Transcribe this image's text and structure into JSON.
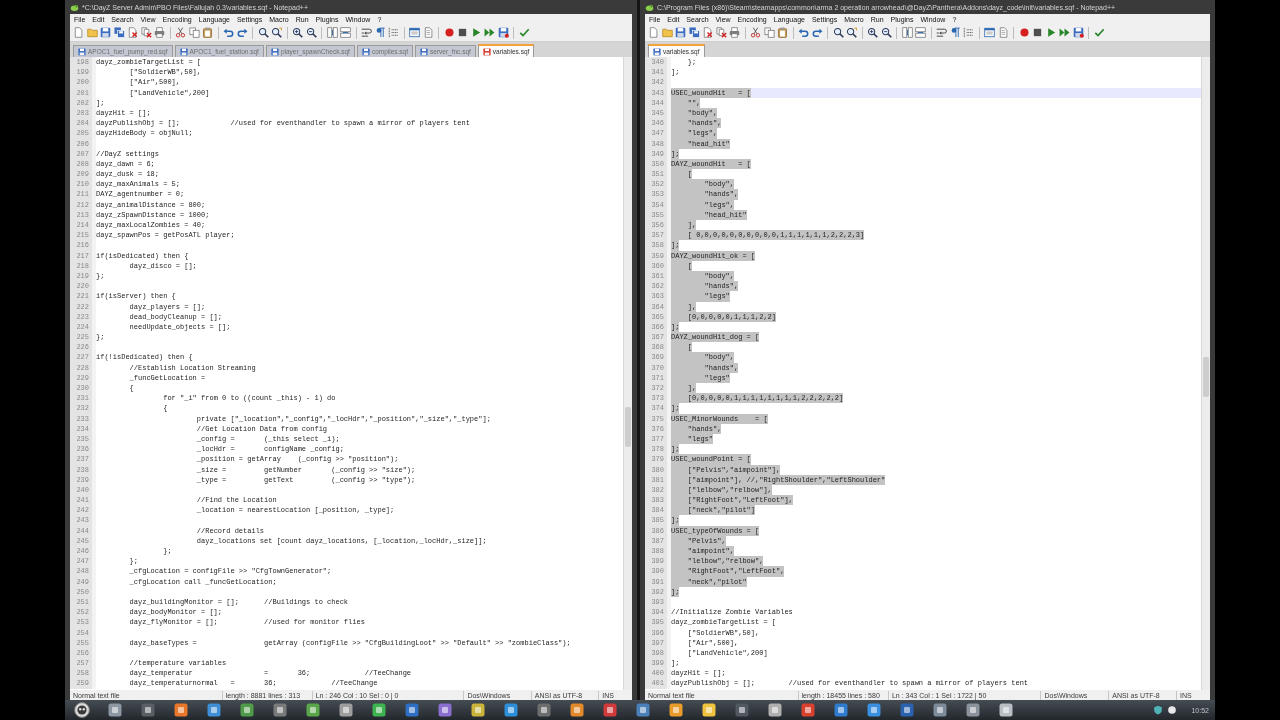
{
  "windows": [
    {
      "title": "*C:\\DayZ Server Admin\\PBO Files\\Fallujah 0.3\\variables.sqf - Notepad++",
      "menu": [
        "File",
        "Edit",
        "Search",
        "View",
        "Encoding",
        "Language",
        "Settings",
        "Macro",
        "Run",
        "Plugins",
        "Window",
        "?"
      ],
      "tabs": [
        {
          "label": "APOC1_fuel_pump_red.sqf",
          "selected": false,
          "modified": false
        },
        {
          "label": "APOC1_fuel_station.sqf",
          "selected": false,
          "modified": false
        },
        {
          "label": "player_spawnCheck.sqf",
          "selected": false,
          "modified": false
        },
        {
          "label": "compiles.sqf",
          "selected": false,
          "modified": false
        },
        {
          "label": "server_fnc.sqf",
          "selected": false,
          "modified": false
        },
        {
          "label": "variables.sqf",
          "selected": true,
          "modified": true
        }
      ],
      "editor": {
        "lines": [
          {
            "number": "198",
            "text": "dayz_zombieTargetList = [",
            "selected": false,
            "current": false
          },
          {
            "number": "199",
            "text": "\t[\"SoldierWB\",50],",
            "selected": false,
            "current": false
          },
          {
            "number": "200",
            "text": "\t[\"Air\",500],",
            "selected": false,
            "current": false
          },
          {
            "number": "201",
            "text": "\t[\"LandVehicle\",200]",
            "selected": false,
            "current": false
          },
          {
            "number": "202",
            "text": "];",
            "selected": false,
            "current": false
          },
          {
            "number": "203",
            "text": "dayzHit = [];",
            "selected": false,
            "current": false
          },
          {
            "number": "204",
            "text": "dayzPublishObj = [];\t\t//used for eventhandler to spawn a mirror of players tent",
            "selected": false,
            "current": false
          },
          {
            "number": "205",
            "text": "dayzHideBody = objNull;",
            "selected": false,
            "current": false
          },
          {
            "number": "206",
            "selected": false,
            "current": false
          },
          {
            "number": "207",
            "text": "//DayZ settings",
            "selected": false,
            "current": false
          },
          {
            "number": "208",
            "text": "dayz_dawn = 6;",
            "selected": false,
            "current": false
          },
          {
            "number": "209",
            "text": "dayz_dusk = 18;",
            "selected": false,
            "current": false
          },
          {
            "number": "210",
            "text": "dayz_maxAnimals = 5;",
            "selected": false,
            "current": false
          },
          {
            "number": "211",
            "text": "DAYZ_agentnumber = 0;",
            "selected": false,
            "current": false
          },
          {
            "number": "212",
            "text": "dayz_animalDistance = 800;",
            "selected": false,
            "current": false
          },
          {
            "number": "213",
            "text": "dayz_zSpawnDistance = 1000;",
            "selected": false,
            "current": false
          },
          {
            "number": "214",
            "text": "dayz_maxLocalZombies = 40;",
            "selected": false,
            "current": false
          },
          {
            "number": "215",
            "text": "dayz_spawnPos = getPosATL player;",
            "selected": false,
            "current": false
          },
          {
            "number": "216",
            "selected": false,
            "current": false
          },
          {
            "number": "217",
            "text": "if(isDedicated) then {",
            "selected": false,
            "current": false
          },
          {
            "number": "218",
            "text": "\tdayz_disco = [];",
            "selected": false,
            "current": false
          },
          {
            "number": "219",
            "text": "};",
            "selected": false,
            "current": false
          },
          {
            "number": "220",
            "selected": false,
            "current": false
          },
          {
            "number": "221",
            "text": "if(isServer) then {",
            "selected": false,
            "current": false
          },
          {
            "number": "222",
            "text": "\tdayz_players = [];",
            "selected": false,
            "current": false
          },
          {
            "number": "223",
            "text": "\tdead_bodyCleanup = [];",
            "selected": false,
            "current": false
          },
          {
            "number": "224",
            "text": "\tneedUpdate_objects = [];",
            "selected": false,
            "current": false
          },
          {
            "number": "225",
            "text": "};",
            "selected": false,
            "current": false
          },
          {
            "number": "226",
            "selected": false,
            "current": false
          },
          {
            "number": "227",
            "text": "if(!isDedicated) then {",
            "selected": false,
            "current": false
          },
          {
            "number": "228",
            "text": "\t//Establish Location Streaming",
            "selected": false,
            "current": false
          },
          {
            "number": "229",
            "text": "\t_funcGetLocation =",
            "selected": false,
            "current": false
          },
          {
            "number": "230",
            "text": "\t{",
            "selected": false,
            "current": false
          },
          {
            "number": "231",
            "text": "\t\tfor \"_i\" from 0 to ((count _this) - 1) do",
            "selected": false,
            "current": false
          },
          {
            "number": "232",
            "text": "\t\t{",
            "selected": false,
            "current": false
          },
          {
            "number": "233",
            "text": "\t\t\tprivate [\"_location\",\"_config\",\"_locHdr\",\"_position\",\"_size\",\"_type\"];",
            "selected": false,
            "current": false
          },
          {
            "number": "234",
            "text": "\t\t\t//Get Location Data from config",
            "selected": false,
            "current": false
          },
          {
            "number": "235",
            "text": "\t\t\t_config = \t(_this select _i);",
            "selected": false,
            "current": false
          },
          {
            "number": "236",
            "text": "\t\t\t_locHdr = \tconfigName _config;",
            "selected": false,
            "current": false
          },
          {
            "number": "237",
            "text": "\t\t\t_position = getArray\t(_config >> \"position\");",
            "selected": false,
            "current": false
          },
          {
            "number": "238",
            "text": "\t\t\t_size = \tgetNumber\t(_config >> \"size\");",
            "selected": false,
            "current": false
          },
          {
            "number": "239",
            "text": "\t\t\t_type = \tgetText\t\t(_config >> \"type\");",
            "selected": false,
            "current": false
          },
          {
            "number": "240",
            "selected": false,
            "current": false
          },
          {
            "number": "241",
            "text": "\t\t\t//Find the Location",
            "selected": false,
            "current": false
          },
          {
            "number": "242",
            "text": "\t\t\t_location = nearestLocation [_position, _type];",
            "selected": false,
            "current": false
          },
          {
            "number": "243",
            "selected": false,
            "current": false
          },
          {
            "number": "244",
            "text": "\t\t\t//Record details",
            "selected": false,
            "current": false
          },
          {
            "number": "245",
            "text": "\t\t\tdayz_locations set [count dayz_locations, [_location,_locHdr,_size]];",
            "selected": false,
            "current": false
          },
          {
            "number": "246",
            "text": "\t\t};",
            "selected": false,
            "current": false
          },
          {
            "number": "247",
            "text": "\t};",
            "selected": false,
            "current": false
          },
          {
            "number": "248",
            "text": "\t_cfgLocation = configFile >> \"CfgTownGenerator\";",
            "selected": false,
            "current": false
          },
          {
            "number": "249",
            "text": "\t_cfgLocation call _funcGetLocation;",
            "selected": false,
            "current": false
          },
          {
            "number": "250",
            "selected": false,
            "current": false
          },
          {
            "number": "251",
            "text": "\tdayz_buildingMonitor = [];\t//Buildings to check",
            "selected": false,
            "current": false
          },
          {
            "number": "252",
            "text": "\tdayz_bodyMonitor = [];",
            "selected": false,
            "current": false
          },
          {
            "number": "253",
            "text": "\tdayz_flyMonitor = [];\t\t//used for monitor flies",
            "selected": false,
            "current": false
          },
          {
            "number": "254",
            "selected": false,
            "current": false
          },
          {
            "number": "255",
            "text": "\tdayz_baseTypes = \t\tgetArray (configFile >> \"CfgBuildingLoot\" >> \"Default\" >> \"zombieClass\");",
            "selected": false,
            "current": false
          },
          {
            "number": "256",
            "selected": false,
            "current": false
          },
          {
            "number": "257",
            "text": "\t//temperature variables",
            "selected": false,
            "current": false
          },
          {
            "number": "258",
            "text": "\tdayz_temperatur \t\t= \t36;\t\t//TeeChange",
            "selected": false,
            "current": false
          },
          {
            "number": "259",
            "text": "\tdayz_temperaturnormal \t= \t36;\t\t//TeeChange",
            "selected": false,
            "current": false
          }
        ]
      },
      "status_bar": [
        "Normal text file",
        "length : 8881    lines : 313",
        "Ln : 246    Col : 10    Sel : 0 | 0",
        "Dos\\Windows",
        "ANSI as UTF-8",
        "INS"
      ]
    },
    {
      "title": "C:\\Program Files (x86)\\Steam\\steamapps\\common\\arma 2 operation arrowhead\\@DayZ\\Panthera\\Addons\\dayz_code\\init\\variables.sqf - Notepad++",
      "menu": [
        "File",
        "Edit",
        "Search",
        "View",
        "Encoding",
        "Language",
        "Settings",
        "Macro",
        "Run",
        "Plugins",
        "Window",
        "?"
      ],
      "tabs": [
        {
          "label": "variables.sqf",
          "selected": true,
          "modified": false
        }
      ],
      "editor": {
        "lines": [
          {
            "number": "340",
            "text": "    };",
            "selected": false,
            "current": false
          },
          {
            "number": "341",
            "text": "];",
            "selected": false,
            "current": false
          },
          {
            "number": "342",
            "selected": false,
            "current": false
          },
          {
            "number": "343",
            "text": "USEC_woundHit   = [",
            "selected": true,
            "current": true
          },
          {
            "number": "344",
            "text": "    \"\",",
            "selected": true,
            "current": false
          },
          {
            "number": "345",
            "text": "    \"body\",",
            "selected": true,
            "current": false
          },
          {
            "number": "346",
            "text": "    \"hands\",",
            "selected": true,
            "current": false
          },
          {
            "number": "347",
            "text": "    \"legs\",",
            "selected": true,
            "current": false
          },
          {
            "number": "348",
            "text": "    \"head_hit\"",
            "selected": true,
            "current": false
          },
          {
            "number": "349",
            "text": "];",
            "selected": true,
            "current": false
          },
          {
            "number": "350",
            "text": "DAYZ_woundHit   = [",
            "selected": true,
            "current": false
          },
          {
            "number": "351",
            "text": "    [",
            "selected": true,
            "current": false
          },
          {
            "number": "352",
            "text": "        \"body\",",
            "selected": true,
            "current": false
          },
          {
            "number": "353",
            "text": "        \"hands\",",
            "selected": true,
            "current": false
          },
          {
            "number": "354",
            "text": "        \"legs\",",
            "selected": true,
            "current": false
          },
          {
            "number": "355",
            "text": "        \"head_hit\"",
            "selected": true,
            "current": false
          },
          {
            "number": "356",
            "text": "    ],",
            "selected": true,
            "current": false
          },
          {
            "number": "357",
            "text": "    [ 0,0,0,0,0,0,0,0,0,0,1,1,1,1,1,1,2,2,2,3]",
            "selected": true,
            "current": false
          },
          {
            "number": "358",
            "text": "];",
            "selected": true,
            "current": false
          },
          {
            "number": "359",
            "text": "DAYZ_woundHit_ok = [",
            "selected": true,
            "current": false
          },
          {
            "number": "360",
            "text": "    [",
            "selected": true,
            "current": false
          },
          {
            "number": "361",
            "text": "        \"body\",",
            "selected": true,
            "current": false
          },
          {
            "number": "362",
            "text": "        \"hands\",",
            "selected": true,
            "current": false
          },
          {
            "number": "363",
            "text": "        \"legs\"",
            "selected": true,
            "current": false
          },
          {
            "number": "364",
            "text": "    ],",
            "selected": true,
            "current": false
          },
          {
            "number": "365",
            "text": "    [0,0,0,0,0,1,1,1,2,2]",
            "selected": true,
            "current": false
          },
          {
            "number": "366",
            "text": "];",
            "selected": true,
            "current": false
          },
          {
            "number": "367",
            "text": "DAYZ_woundHit_dog = [",
            "selected": true,
            "current": false
          },
          {
            "number": "368",
            "text": "    [",
            "selected": true,
            "current": false
          },
          {
            "number": "369",
            "text": "        \"body\",",
            "selected": true,
            "current": false
          },
          {
            "number": "370",
            "text": "        \"hands\",",
            "selected": true,
            "current": false
          },
          {
            "number": "371",
            "text": "        \"legs\"",
            "selected": true,
            "current": false
          },
          {
            "number": "372",
            "text": "    ],",
            "selected": true,
            "current": false
          },
          {
            "number": "373",
            "text": "    [0,0,0,0,0,1,1,1,1,1,1,1,1,2,2,2,2,2]",
            "selected": true,
            "current": false
          },
          {
            "number": "374",
            "text": "];",
            "selected": true,
            "current": false
          },
          {
            "number": "375",
            "text": "USEC_MinorWounds    = [",
            "selected": true,
            "current": false
          },
          {
            "number": "376",
            "text": "    \"hands\",",
            "selected": true,
            "current": false
          },
          {
            "number": "377",
            "text": "    \"legs\"",
            "selected": true,
            "current": false
          },
          {
            "number": "378",
            "text": "];",
            "selected": true,
            "current": false
          },
          {
            "number": "379",
            "text": "USEC_woundPoint = [",
            "selected": true,
            "current": false
          },
          {
            "number": "380",
            "text": "    [\"Pelvis\",\"aimpoint\"],",
            "selected": true,
            "current": false
          },
          {
            "number": "381",
            "text": "    [\"aimpoint\"], //,\"RightShoulder\",\"LeftShoulder\"",
            "selected": true,
            "current": false
          },
          {
            "number": "382",
            "text": "    [\"lelbow\",\"relbow\"],",
            "selected": true,
            "current": false
          },
          {
            "number": "383",
            "text": "    [\"RightFoot\",\"LeftFoot\"],",
            "selected": true,
            "current": false
          },
          {
            "number": "384",
            "text": "    [\"neck\",\"pilot\"]",
            "selected": true,
            "current": false
          },
          {
            "number": "385",
            "text": "];",
            "selected": true,
            "current": false
          },
          {
            "number": "386",
            "text": "USEC_typeOfWounds = [",
            "selected": true,
            "current": false
          },
          {
            "number": "387",
            "text": "    \"Pelvis\",",
            "selected": true,
            "current": false
          },
          {
            "number": "388",
            "text": "    \"aimpoint\",",
            "selected": true,
            "current": false
          },
          {
            "number": "389",
            "text": "    \"lelbow\",\"relbow\",",
            "selected": true,
            "current": false
          },
          {
            "number": "390",
            "text": "    \"RightFoot\",\"LeftFoot\",",
            "selected": true,
            "current": false
          },
          {
            "number": "391",
            "text": "    \"neck\",\"pilot\"",
            "selected": true,
            "current": false
          },
          {
            "number": "392",
            "text": "];",
            "selected": true,
            "current": false
          },
          {
            "number": "393",
            "selected": false,
            "current": false
          },
          {
            "number": "394",
            "text": "//Initialize Zombie Variables",
            "selected": false,
            "current": false
          },
          {
            "number": "395",
            "text": "dayz_zombieTargetList = [",
            "selected": false,
            "current": false
          },
          {
            "number": "396",
            "text": "    [\"SoldierWB\",50],",
            "selected": false,
            "current": false
          },
          {
            "number": "397",
            "text": "    [\"Air\",500],",
            "selected": false,
            "current": false
          },
          {
            "number": "398",
            "text": "    [\"LandVehicle\",200]",
            "selected": false,
            "current": false
          },
          {
            "number": "399",
            "text": "];",
            "selected": false,
            "current": false
          },
          {
            "number": "400",
            "text": "dayzHit = [];",
            "selected": false,
            "current": false
          },
          {
            "number": "401",
            "text": "dayzPublishObj = [];        //used for eventhandler to spawn a mirror of players tent",
            "selected": false,
            "current": false
          }
        ]
      },
      "status_bar": [
        "Normal text file",
        "length : 18455    lines : 580",
        "Ln : 343    Col : 1    Sel : 1722 | 50",
        "Dos\\Windows",
        "ANSI as UTF-8",
        "INS"
      ]
    }
  ],
  "taskbar": {
    "clock": "10:52"
  }
}
